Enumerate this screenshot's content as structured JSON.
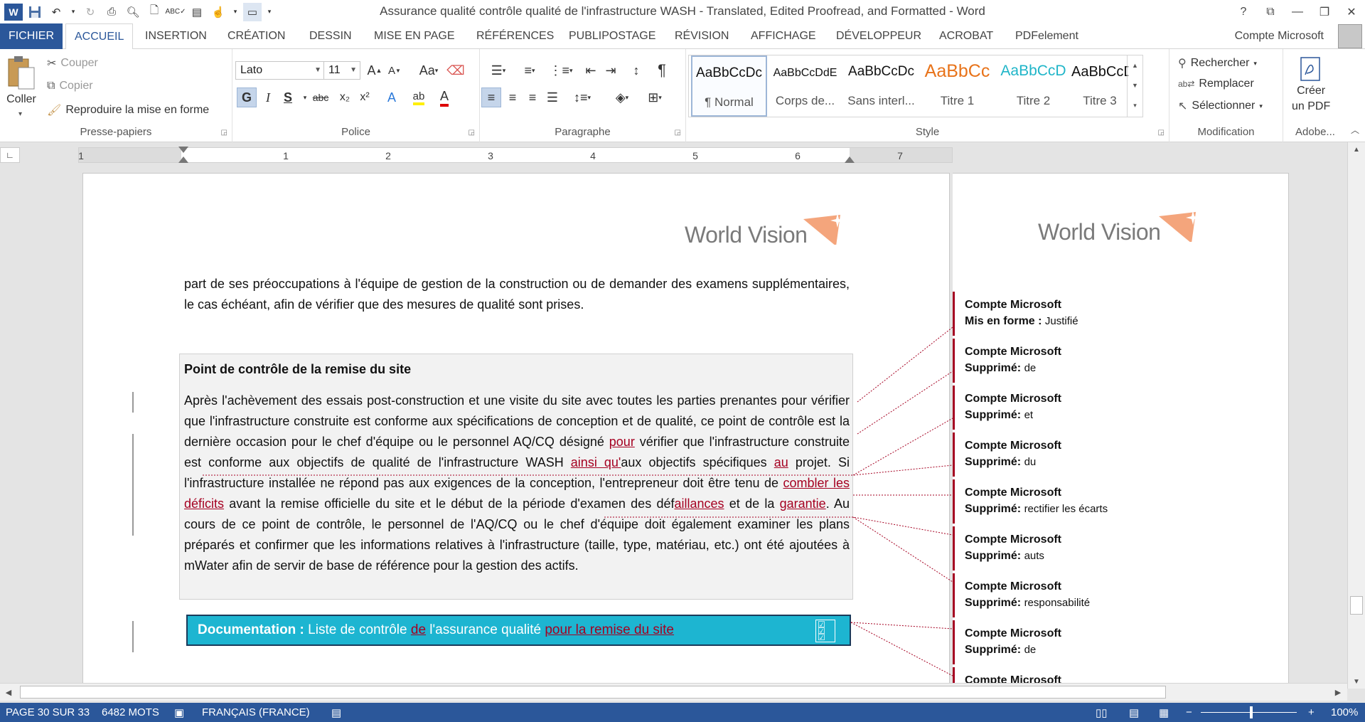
{
  "titlebar": {
    "title": "Assurance qualité  contrôle qualité de l'infrastructure WASH - Translated, Edited Proofread, and Formatted - Word",
    "word_logo": "W",
    "help": "?",
    "controls": [
      "⧉",
      "—",
      "❐",
      "✕"
    ]
  },
  "menu": {
    "tabs": [
      "FICHIER",
      "ACCUEIL",
      "INSERTION",
      "CRÉATION",
      "DESSIN",
      "MISE EN PAGE",
      "RÉFÉRENCES",
      "PUBLIPOSTAGE",
      "RÉVISION",
      "AFFICHAGE",
      "DÉVELOPPEUR",
      "ACROBAT",
      "PDFelement"
    ],
    "active_tab": "ACCUEIL",
    "account": "Compte Microsoft"
  },
  "ribbon": {
    "clipboard": {
      "label": "Presse-papiers",
      "paste": "Coller",
      "cut": "Couper",
      "copy": "Copier",
      "format_painter": "Reproduire la mise en forme"
    },
    "font": {
      "label": "Police",
      "font_name": "Lato",
      "font_size": "11",
      "bold": "G",
      "italic": "I",
      "underline": "S",
      "strike": "abc",
      "subscript": "x₂",
      "superscript": "x²",
      "change_case": "Aa"
    },
    "paragraph": {
      "label": "Paragraphe",
      "pilcrow": "¶"
    },
    "styles": {
      "label": "Style",
      "items": [
        {
          "sample": "AaBbCcDc",
          "name": "¶ Normal",
          "color": "#111111"
        },
        {
          "sample": "AaBbCcDdE",
          "name": "Corps de...",
          "color": "#111111"
        },
        {
          "sample": "AaBbCcDc",
          "name": "Sans interl...",
          "color": "#111111"
        },
        {
          "sample": "AaBbCc",
          "name": "Titre 1",
          "color": "#e8731a"
        },
        {
          "sample": "AaBbCcD",
          "name": "Titre 2",
          "color": "#1fb5c8"
        },
        {
          "sample": "AaBbCcD",
          "name": "Titre 3",
          "color": "#111111"
        }
      ]
    },
    "editing": {
      "label": "Modification",
      "find": "Rechercher",
      "replace": "Remplacer",
      "select": "Sélectionner"
    },
    "adobe": {
      "label": "Adobe...",
      "create_pdf_line1": "Créer",
      "create_pdf_line2": "un PDF"
    }
  },
  "ruler": {
    "numbers": [
      "1",
      "1",
      "2",
      "3",
      "4",
      "5",
      "6",
      "7"
    ]
  },
  "document": {
    "logo_text": "World Vision",
    "intro": "part de ses préoccupations à l'équipe de gestion de la construction ou de demander des examens supplémentaires, le cas échéant, afin de vérifier que des mesures de qualité sont prises.",
    "box_title": "Point de contrôle de la remise du site",
    "box_p": [
      {
        "t": "Après l'achèvement des essais post-construction et une visite du site avec toutes les parties prenantes pour vérifier que l'infrastructure construite est conforme aux spécifications de conception et de qualité, ce point de contrôle est la dernière occasion pour le chef d'équipe ou le personnel AQ/CQ désigné ",
        "ins": false
      },
      {
        "t": "pour",
        "ins": true
      },
      {
        "t": " vérifier que l'infrastructure construite est conforme aux objectifs de qualité de l'infrastructure WASH ",
        "ins": false
      },
      {
        "t": "ainsi qu'",
        "ins": true
      },
      {
        "t": "aux objectifs spécifiques ",
        "ins": false
      },
      {
        "t": "au",
        "ins": true
      },
      {
        "t": " projet. Si l'infrastructure installée ne répond pas aux exigences de la conception, l'entrepreneur doit être tenu de ",
        "ins": false
      },
      {
        "t": "combler les déficits",
        "ins": true
      },
      {
        "t": " avant la remise officielle du site et le début de la période d'examen des déf",
        "ins": false
      },
      {
        "t": "aillances",
        "ins": true
      },
      {
        "t": " et de la ",
        "ins": false
      },
      {
        "t": "garantie",
        "ins": true
      },
      {
        "t": ". Au cours de ce point de contrôle, le personnel de l'AQ/CQ ou le chef d'équipe doit également examiner les plans préparés et confirmer que les informations relatives à l'infrastructure (taille, type, matériau, etc.) ont été ajoutées à mWater afin de servir de base de référence pour la gestion des actifs.",
        "ins": false
      }
    ],
    "doc_label": "Documentation : ",
    "doc_p": [
      {
        "t": "Liste de contrôle ",
        "ins": false
      },
      {
        "t": "de",
        "ins": true
      },
      {
        "t": " l'assurance qualité ",
        "ins": false
      },
      {
        "t": "pour la remise du site",
        "ins": true
      }
    ]
  },
  "comments": [
    {
      "author": "Compte Microsoft",
      "kind": "Mis en forme : ",
      "value": "Justifié"
    },
    {
      "author": "Compte Microsoft",
      "kind": "Supprimé: ",
      "value": "de"
    },
    {
      "author": "Compte Microsoft",
      "kind": "Supprimé: ",
      "value": "et"
    },
    {
      "author": "Compte Microsoft",
      "kind": "Supprimé: ",
      "value": "du"
    },
    {
      "author": "Compte Microsoft",
      "kind": "Supprimé: ",
      "value": "rectifier les écarts"
    },
    {
      "author": "Compte Microsoft",
      "kind": "Supprimé: ",
      "value": "auts"
    },
    {
      "author": "Compte Microsoft",
      "kind": "Supprimé: ",
      "value": "responsabilité"
    },
    {
      "author": "Compte Microsoft",
      "kind": "Supprimé: ",
      "value": "de"
    },
    {
      "author": "Compte Microsoft",
      "kind": "",
      "value": ""
    }
  ],
  "status": {
    "page": "PAGE 30 SUR 33",
    "words": "6482 MOTS",
    "language": "FRANÇAIS (FRANCE)",
    "zoom": "100%",
    "zoom_minus": "−",
    "zoom_plus": "+"
  },
  "colors": {
    "accent": "#2b579a",
    "revision": "#a50021",
    "doc_bar": "#1db5d1",
    "logo_orange": "#f4a57c"
  }
}
